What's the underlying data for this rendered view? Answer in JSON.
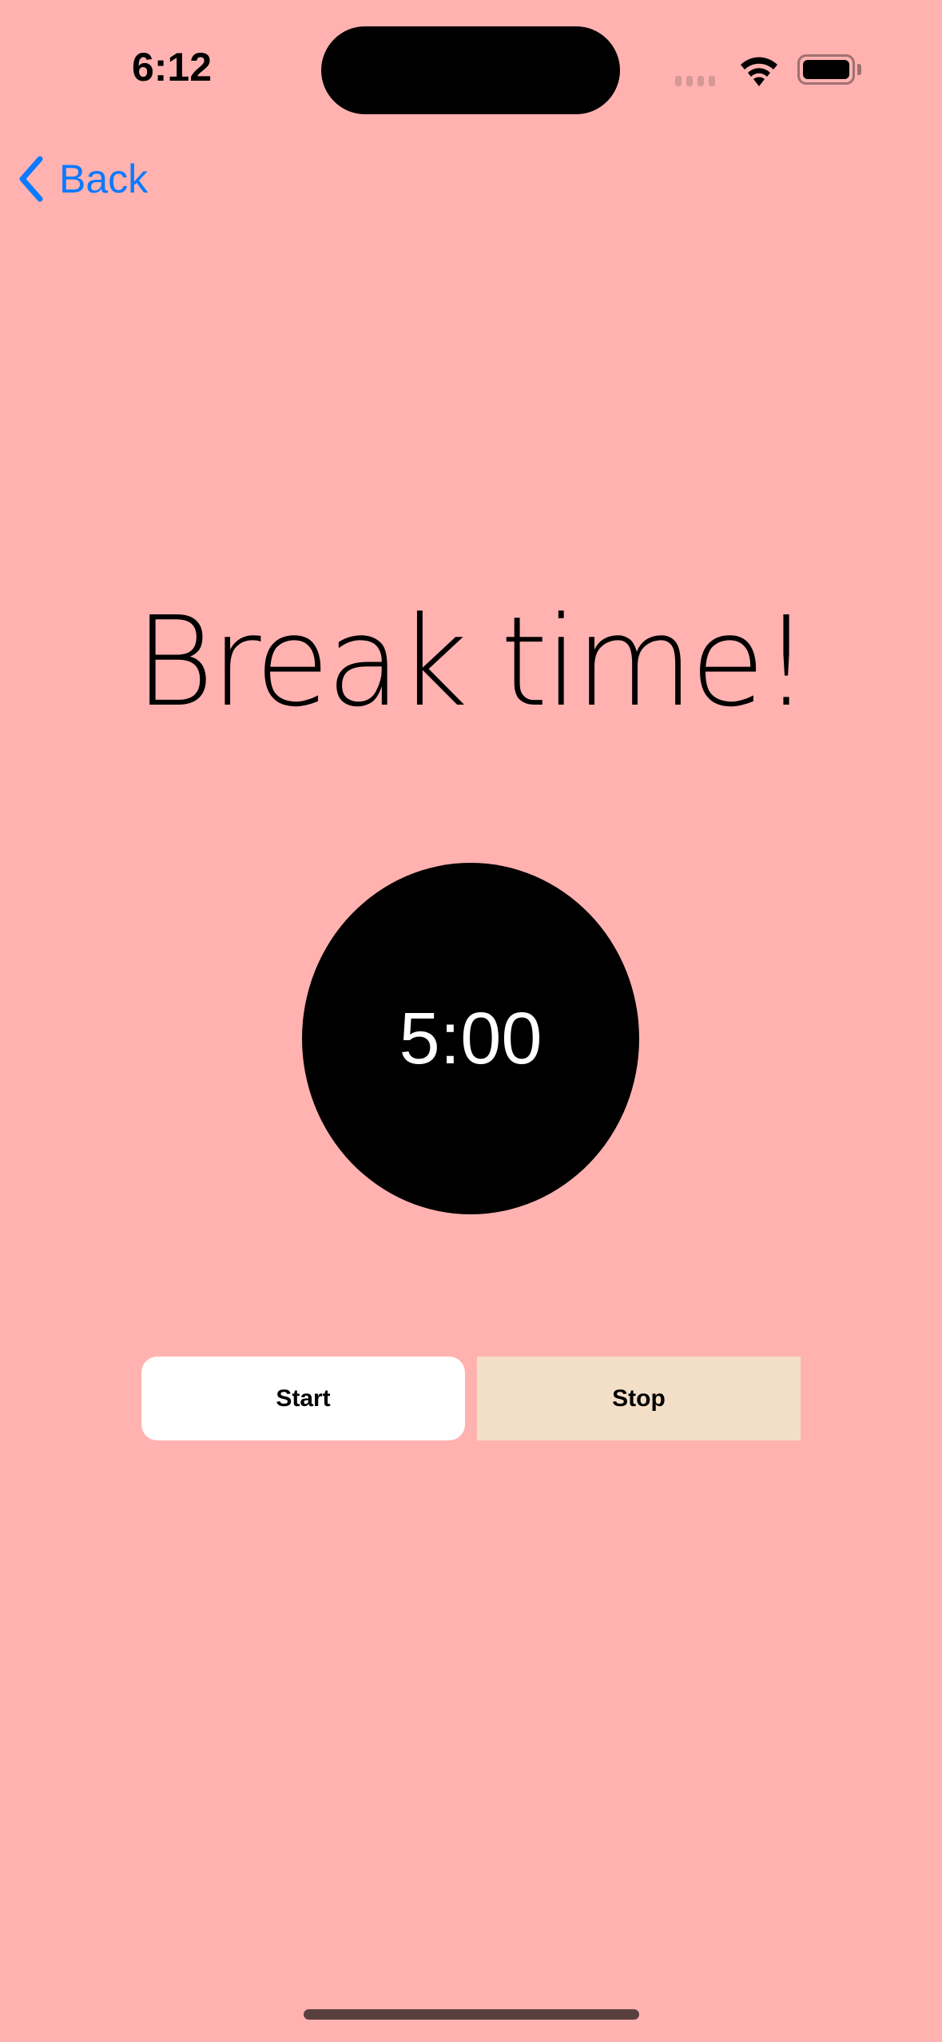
{
  "status_bar": {
    "time": "6:12",
    "battery_level": 1.0
  },
  "nav": {
    "back_label": "Back"
  },
  "main": {
    "title": "Break time!",
    "timer": "5:00",
    "start_label": "Start",
    "stop_label": "Stop"
  },
  "colors": {
    "background": "#FFB2B0",
    "accent": "#0A7AFF",
    "stop_button": "#F3DFC8",
    "timer_circle": "#000000"
  }
}
